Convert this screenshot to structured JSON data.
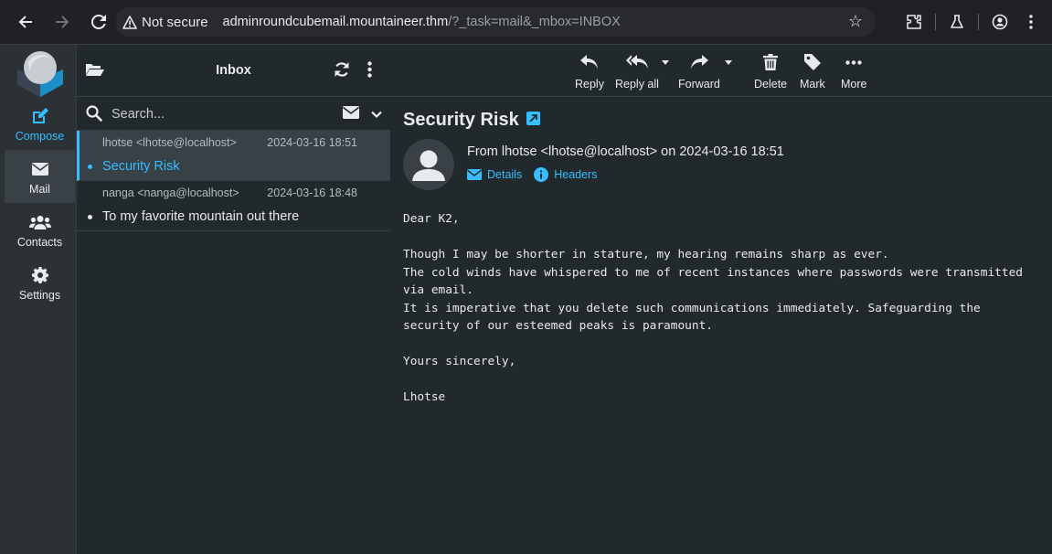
{
  "browser": {
    "security_label": "Not secure",
    "url_host": "adminroundcubemail.mountaineer.thm",
    "url_path": "/?_task=mail&_mbox=INBOX"
  },
  "taskmenu": {
    "items": [
      {
        "label": "Compose",
        "icon": "compose-icon"
      },
      {
        "label": "Mail",
        "icon": "mail-icon"
      },
      {
        "label": "Contacts",
        "icon": "contacts-icon"
      },
      {
        "label": "Settings",
        "icon": "gear-icon"
      }
    ]
  },
  "list": {
    "title": "Inbox",
    "search_placeholder": "Search...",
    "messages": [
      {
        "from": "lhotse <lhotse@localhost>",
        "date": "2024-03-16 18:51",
        "subject": "Security Risk"
      },
      {
        "from": "nanga <nanga@localhost>",
        "date": "2024-03-16 18:48",
        "subject": "To my favorite mountain out there"
      }
    ]
  },
  "toolbar": {
    "reply": "Reply",
    "reply_all": "Reply all",
    "forward": "Forward",
    "delete": "Delete",
    "mark": "Mark",
    "more": "More"
  },
  "message": {
    "subject": "Security Risk",
    "from_line": "From lhotse <lhotse@localhost> on 2024-03-16 18:51",
    "details_label": "Details",
    "headers_label": "Headers",
    "body": "Dear K2,\n\nThough I may be shorter in stature, my hearing remains sharp as ever.\nThe cold winds have whispered to me of recent instances where passwords were transmitted\nvia email.\nIt is imperative that you delete such communications immediately. Safeguarding the\nsecurity of our esteemed peaks is paramount.\n\nYours sincerely,\n\nLhotse"
  },
  "colors": {
    "accent": "#37beff",
    "background": "#21292c",
    "sidebar": "#2c3135"
  }
}
